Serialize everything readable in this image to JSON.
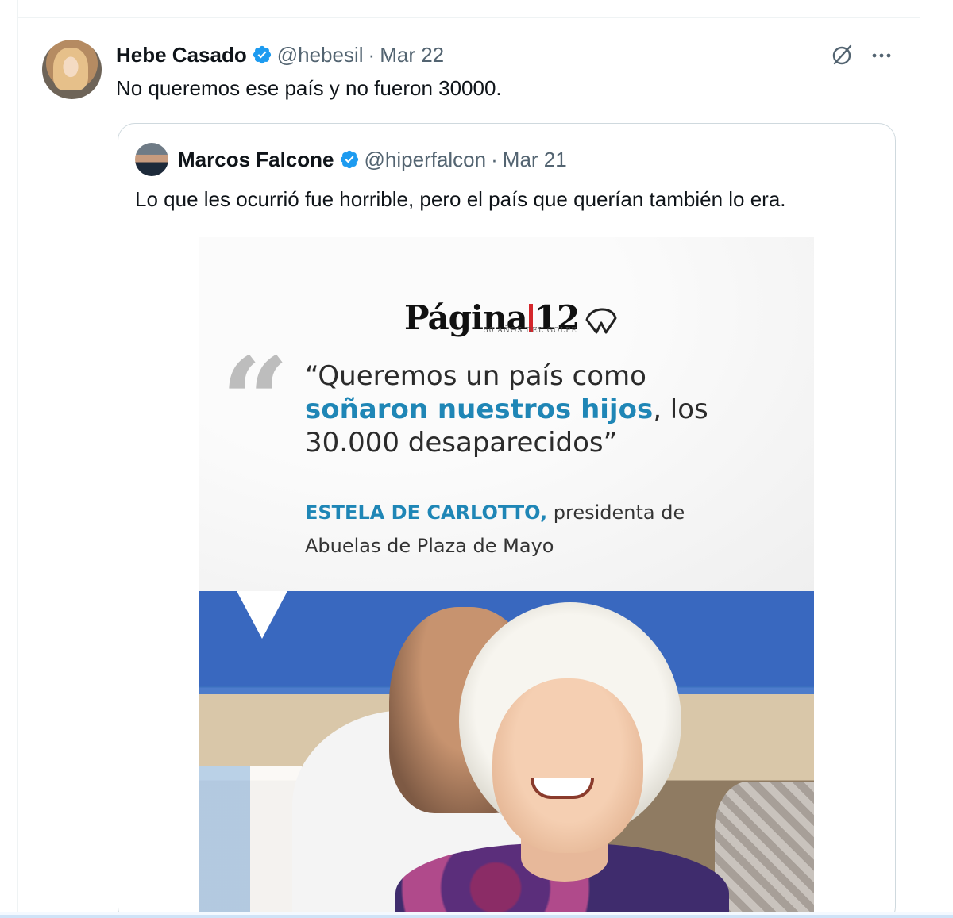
{
  "tweet": {
    "author_name": "Hebe Casado",
    "handle": "@hebesil",
    "separator": "·",
    "date": "Mar 22",
    "text": "No queremos ese país y no fueron 30000.",
    "icons": {
      "avatar": "avatar",
      "verified": "verified-badge-icon",
      "grok": "grok-icon",
      "more": "more-icon"
    }
  },
  "quoted_tweet": {
    "author_name": "Marcos Falcone",
    "handle": "@hiperfalcon",
    "separator": "·",
    "date": "Mar 21",
    "text": "Lo que les ocurrió fue horrible, pero el país que querían también lo era.",
    "media": {
      "logo_word": "Página",
      "logo_number": "12",
      "logo_subtitle": "50 AÑOS DEL GOLPE",
      "quote_line1": "“Queremos un país como",
      "quote_highlight": "soñaron nuestros hijos",
      "quote_line2_rest": ", los",
      "quote_line3": "30.000 desaparecidos”",
      "attribution_name": "ESTELA DE CARLOTTO,",
      "attribution_role": " presidenta de",
      "attribution_org": "Abuelas de Plaza de Mayo",
      "colors": {
        "highlight": "#1f86b6",
        "logo_bar": "#d4262b"
      }
    }
  },
  "colors": {
    "verified": "#1d9bf0",
    "muted_text": "#536471",
    "border": "#cfd9de"
  }
}
